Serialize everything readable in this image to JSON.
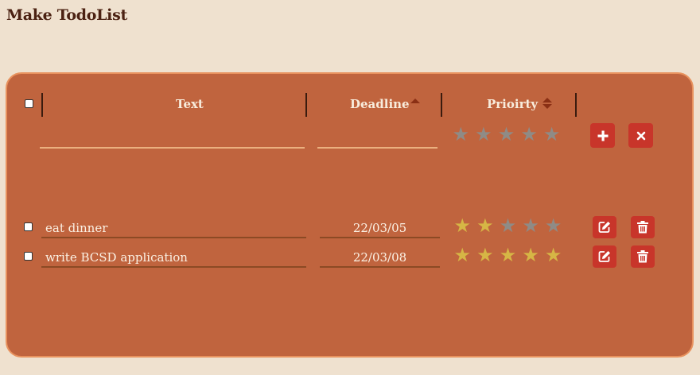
{
  "app": {
    "title": "Make TodoList"
  },
  "colors": {
    "page_bg": "#efe1cf",
    "panel_bg": "#c0643e",
    "panel_border": "#e8925e",
    "button_red": "#c8352a",
    "star_on": "#d6b645",
    "star_off": "#8f8b86",
    "sort_arrow": "#8a2f14"
  },
  "header": {
    "select_all_checked": false,
    "columns": [
      {
        "label": "Text",
        "sort": "none"
      },
      {
        "label": "Deadline",
        "sort": "ascending"
      },
      {
        "label": "Prioirty",
        "sort": "both"
      }
    ]
  },
  "new_item": {
    "text_value": "",
    "deadline_value": "",
    "priority": 0,
    "max_priority": 5,
    "add_icon": "plus-icon",
    "cancel_icon": "close-icon"
  },
  "todos": [
    {
      "checked": false,
      "text": "eat dinner",
      "deadline": "22/03/05",
      "priority": 2,
      "edit_icon": "edit-icon",
      "delete_icon": "trash-icon"
    },
    {
      "checked": false,
      "text": "write BCSD application",
      "deadline": "22/03/08",
      "priority": 5,
      "edit_icon": "edit-icon",
      "delete_icon": "trash-icon"
    }
  ]
}
